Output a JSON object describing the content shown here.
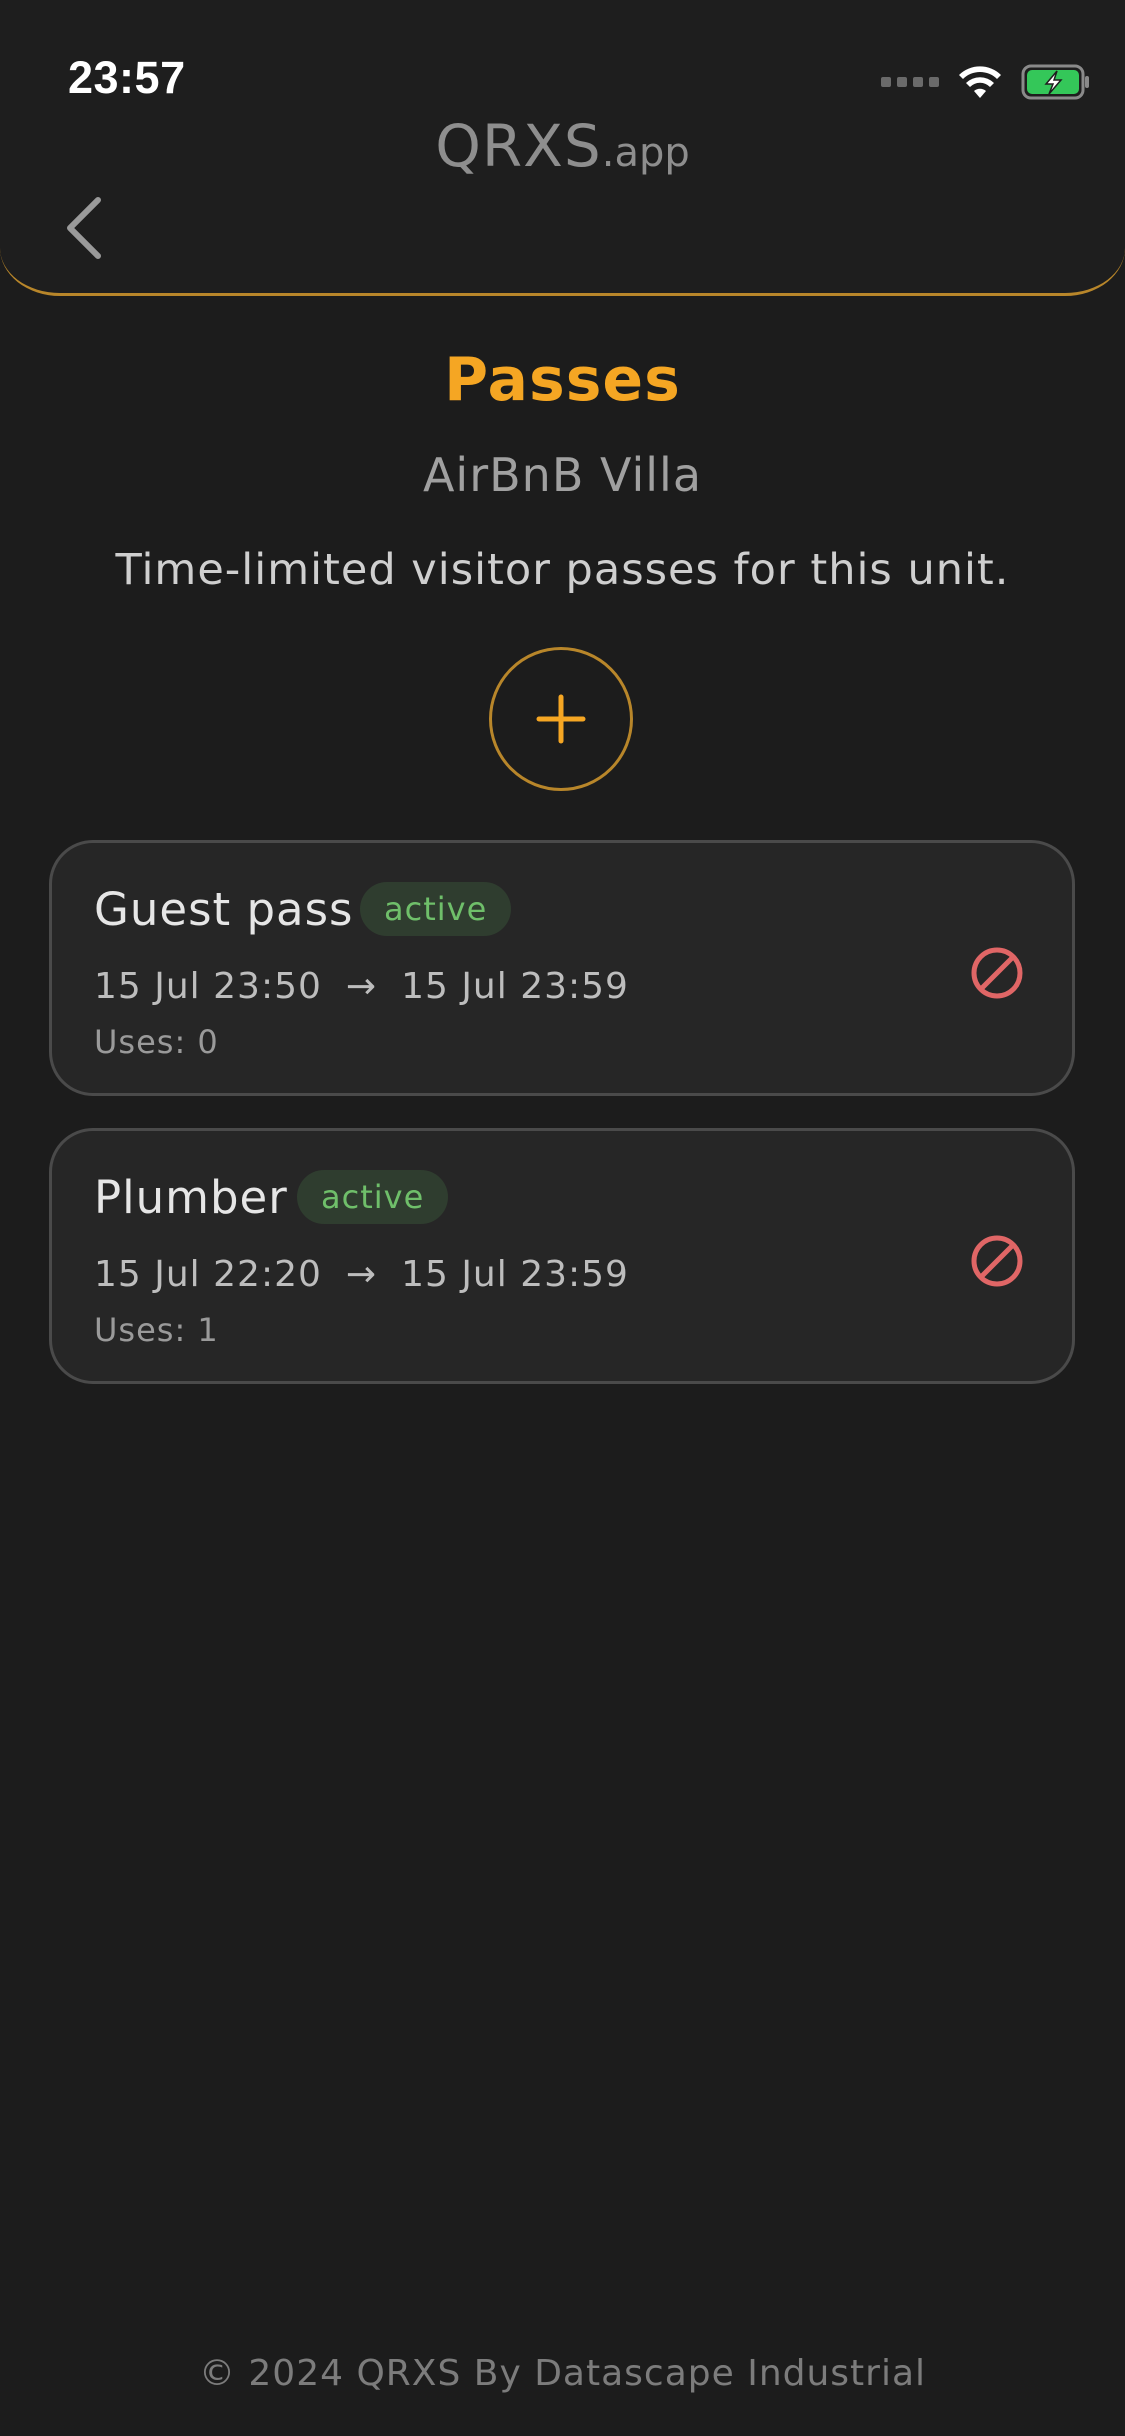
{
  "status_bar": {
    "time": "23:57"
  },
  "header": {
    "brand_main": "QRXS",
    "brand_suffix": ".app",
    "back_icon": "chevron-left-icon"
  },
  "page": {
    "title": "Passes",
    "subtitle": "AirBnB Villa",
    "description": "Time-limited visitor passes for this unit.",
    "add_icon": "plus-icon"
  },
  "passes": [
    {
      "name": "Guest pass",
      "status": "active",
      "start": "15 Jul 23:50",
      "end": "15 Jul 23:59",
      "uses": "Uses: 0",
      "revoke_icon": "revoke-icon"
    },
    {
      "name": "Plumber",
      "status": "active",
      "start": "15 Jul 22:20",
      "end": "15 Jul 23:59",
      "uses": "Uses: 1",
      "revoke_icon": "revoke-icon"
    }
  ],
  "arrow_glyph": "→",
  "footer": {
    "text": "© 2024 QRXS By Datascape Industrial"
  },
  "colors": {
    "background": "#1c1c1c",
    "accent": "#f5a623",
    "accent_border": "#b8862a",
    "badge_bg": "#2f3d2f",
    "badge_text": "#6fbf6a",
    "revoke": "#e06666",
    "battery": "#34c759"
  }
}
